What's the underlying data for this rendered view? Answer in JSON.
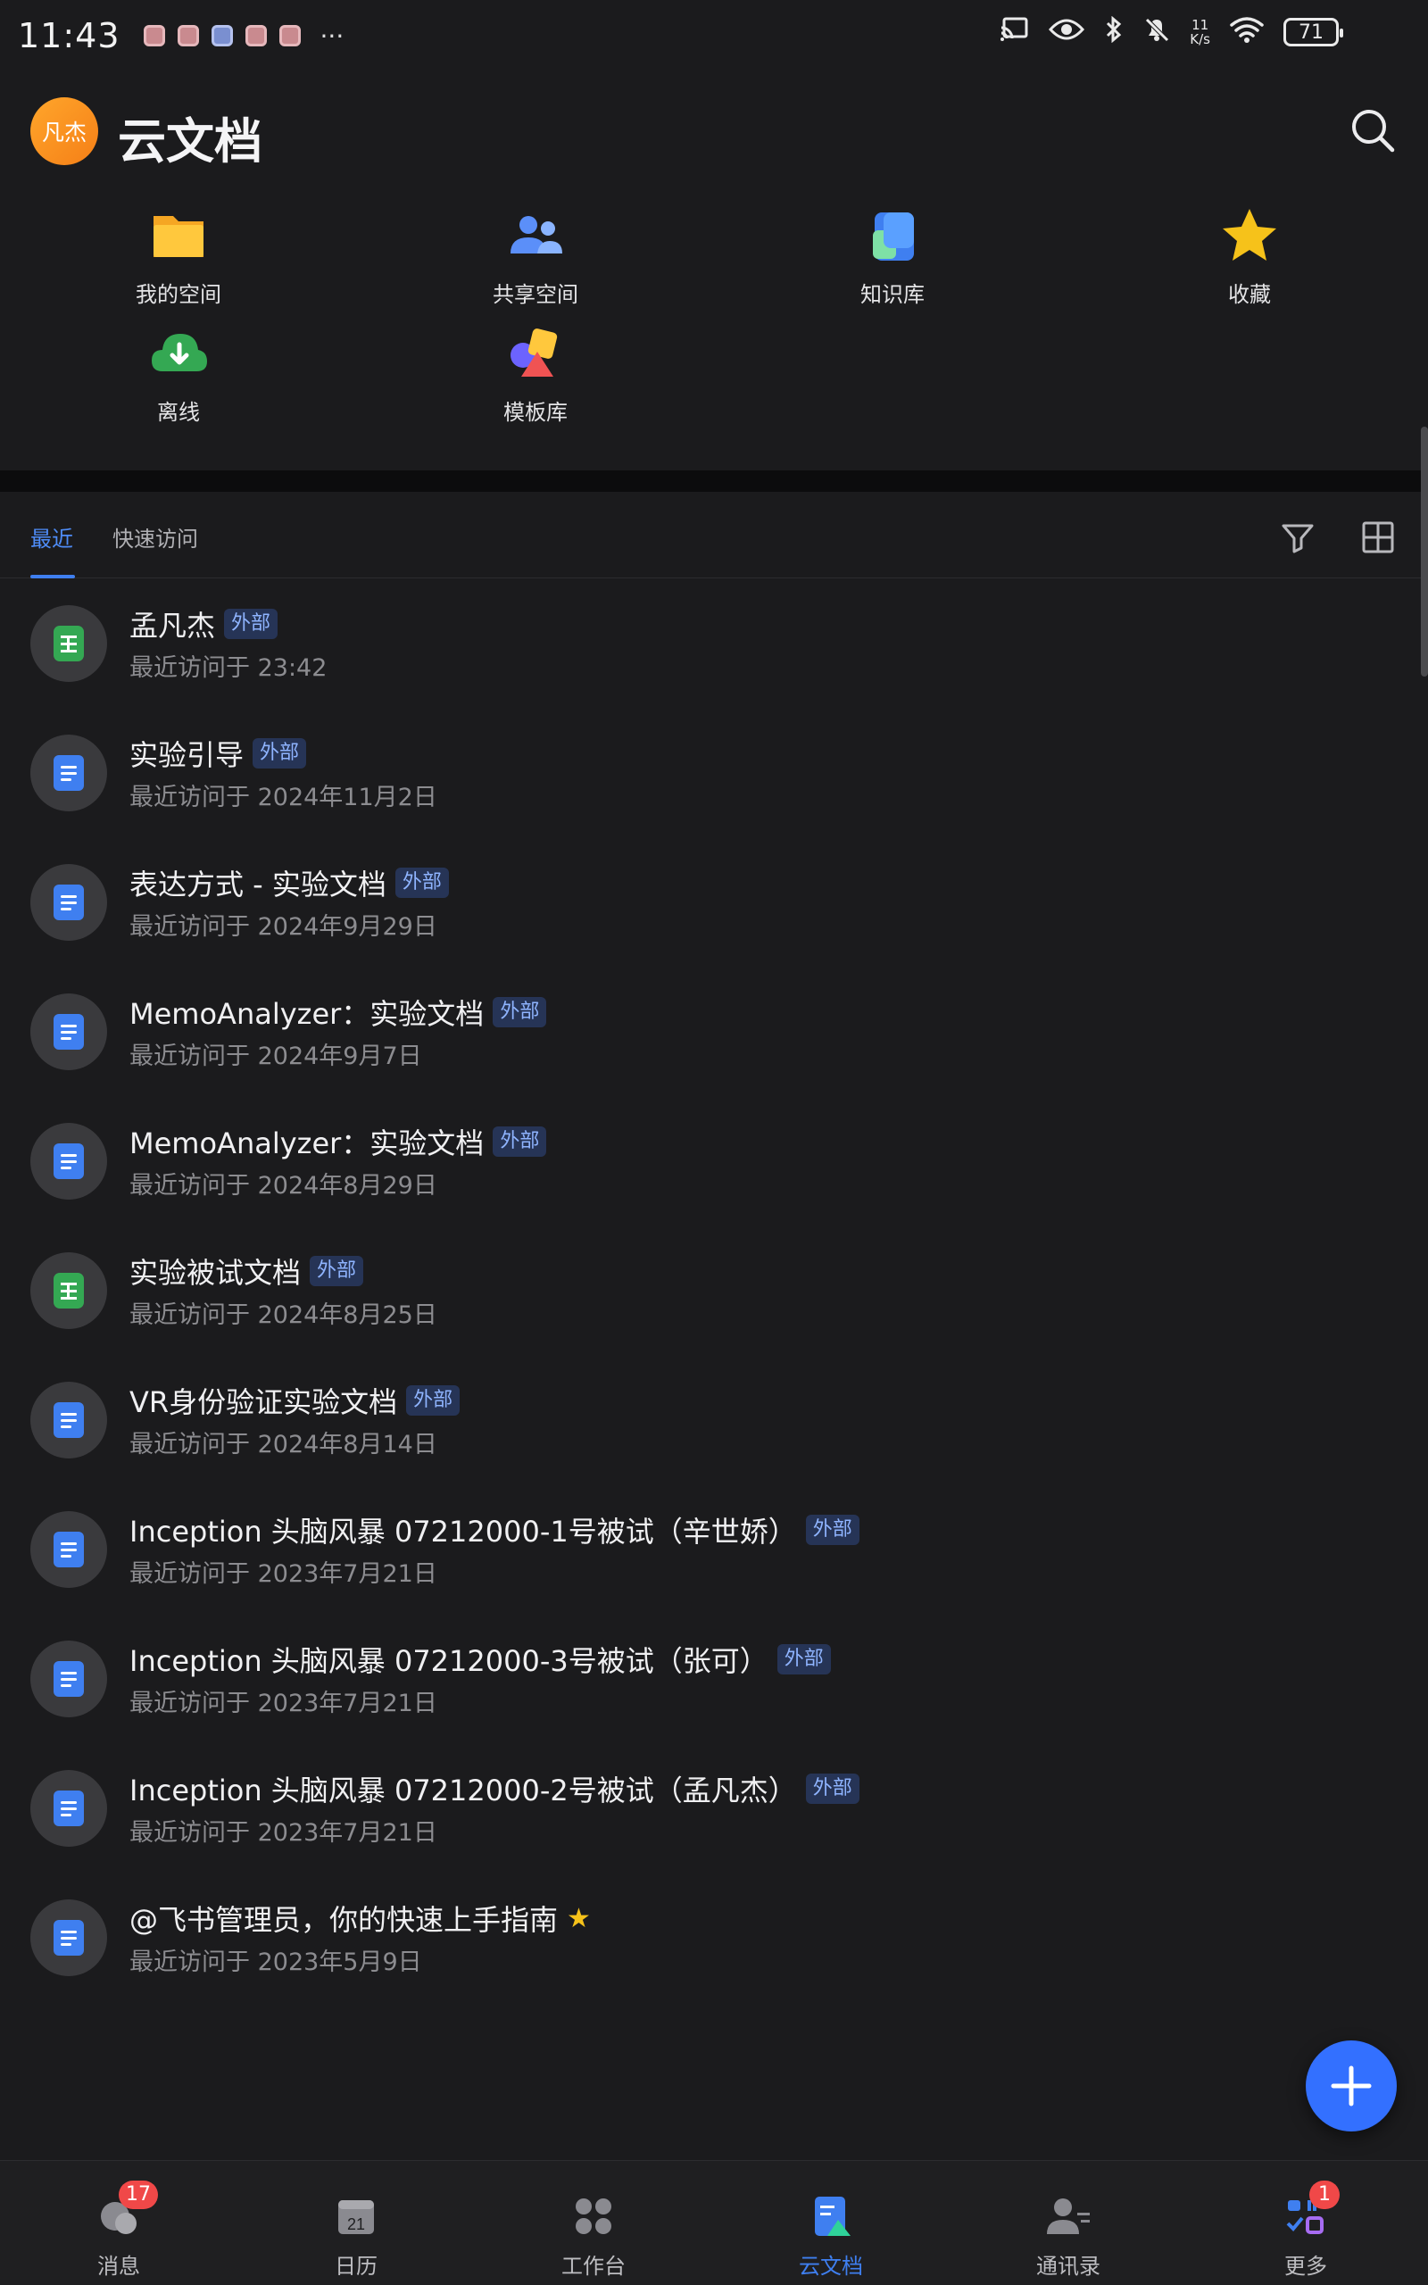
{
  "status_bar": {
    "time": "11:43",
    "more": "···",
    "net_speed_value": "11",
    "net_speed_unit": "K/s",
    "battery": "71"
  },
  "header": {
    "avatar_text": "凡杰",
    "title": "云文档"
  },
  "quick_access": [
    {
      "label": "我的空间",
      "icon": "folder-icon"
    },
    {
      "label": "共享空间",
      "icon": "shared-space-icon"
    },
    {
      "label": "知识库",
      "icon": "knowledge-base-icon"
    },
    {
      "label": "收藏",
      "icon": "star-icon"
    },
    {
      "label": "离线",
      "icon": "offline-download-icon"
    },
    {
      "label": "模板库",
      "icon": "template-library-icon"
    }
  ],
  "tabs": [
    {
      "label": "最近",
      "active": true
    },
    {
      "label": "快速访问",
      "active": false
    }
  ],
  "documents": [
    {
      "title": "孟凡杰",
      "badge": "外部",
      "subtitle": "最近访问于 23:42",
      "type": "sheet"
    },
    {
      "title": "实验引导",
      "badge": "外部",
      "subtitle": "最近访问于 2024年11月2日",
      "type": "doc"
    },
    {
      "title": "表达方式 - 实验文档",
      "badge": "外部",
      "subtitle": "最近访问于 2024年9月29日",
      "type": "doc"
    },
    {
      "title": "MemoAnalyzer：实验文档",
      "badge": "外部",
      "subtitle": "最近访问于 2024年9月7日",
      "type": "doc"
    },
    {
      "title": "MemoAnalyzer：实验文档",
      "badge": "外部",
      "subtitle": "最近访问于 2024年8月29日",
      "type": "doc"
    },
    {
      "title": "实验被试文档",
      "badge": "外部",
      "subtitle": "最近访问于 2024年8月25日",
      "type": "sheet"
    },
    {
      "title": "VR身份验证实验文档",
      "badge": "外部",
      "subtitle": "最近访问于 2024年8月14日",
      "type": "doc"
    },
    {
      "title": "Inception 头脑风暴 07212000-1号被试（辛世娇）",
      "badge": "外部",
      "subtitle": "最近访问于 2023年7月21日",
      "type": "doc"
    },
    {
      "title": "Inception 头脑风暴 07212000-3号被试（张可）",
      "badge": "外部",
      "subtitle": "最近访问于 2023年7月21日",
      "type": "doc"
    },
    {
      "title": "Inception 头脑风暴 07212000-2号被试（孟凡杰）",
      "badge": "外部",
      "subtitle": "最近访问于 2023年7月21日",
      "type": "doc"
    },
    {
      "title": "@飞书管理员，你的快速上手指南",
      "badge": "",
      "starred": true,
      "subtitle": "最近访问于 2023年5月9日",
      "type": "doc"
    }
  ],
  "bottom_nav": [
    {
      "label": "消息",
      "badge": "17",
      "icon": "message-icon",
      "active": false
    },
    {
      "label": "日历",
      "badge": "",
      "icon": "calendar-icon",
      "calendar_day": "21",
      "active": false
    },
    {
      "label": "工作台",
      "badge": "",
      "icon": "workbench-icon",
      "active": false
    },
    {
      "label": "云文档",
      "badge": "",
      "icon": "cloud-docs-icon",
      "active": true
    },
    {
      "label": "通讯录",
      "badge": "",
      "icon": "contacts-icon",
      "active": false
    },
    {
      "label": "更多",
      "badge": "1",
      "icon": "more-apps-icon",
      "active": false
    }
  ],
  "colors": {
    "background": "#1b1b1d",
    "accent": "#3370ff",
    "badge_bg": "#263456",
    "badge_text": "#8fb4ff",
    "star": "#f6c21a"
  }
}
